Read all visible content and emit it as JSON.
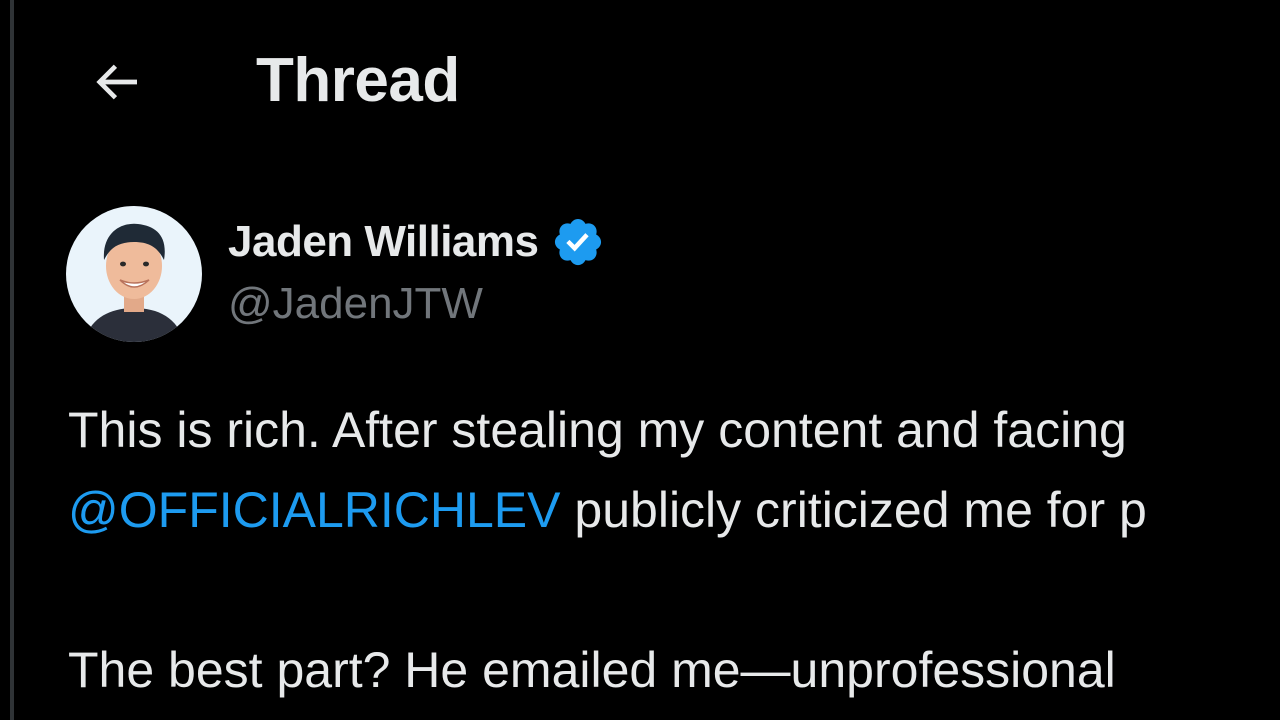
{
  "header": {
    "title": "Thread",
    "back_icon": "arrow-left-icon"
  },
  "tweet": {
    "author": {
      "display_name": "Jaden Williams",
      "handle": "@JadenJTW",
      "verified": true,
      "verified_icon": "verified-badge-icon"
    },
    "line1": "This is rich. After stealing my content and facing",
    "line2_mention": "@OFFICIALRICHLEV",
    "line2_text": " publicly criticized me for p",
    "line3": "The best part? He emailed me—unprofessional"
  },
  "colors": {
    "background": "#000000",
    "text": "#e7e9ea",
    "secondary_text": "#71767b",
    "accent": "#1d9bf0",
    "border": "#2f3336"
  }
}
